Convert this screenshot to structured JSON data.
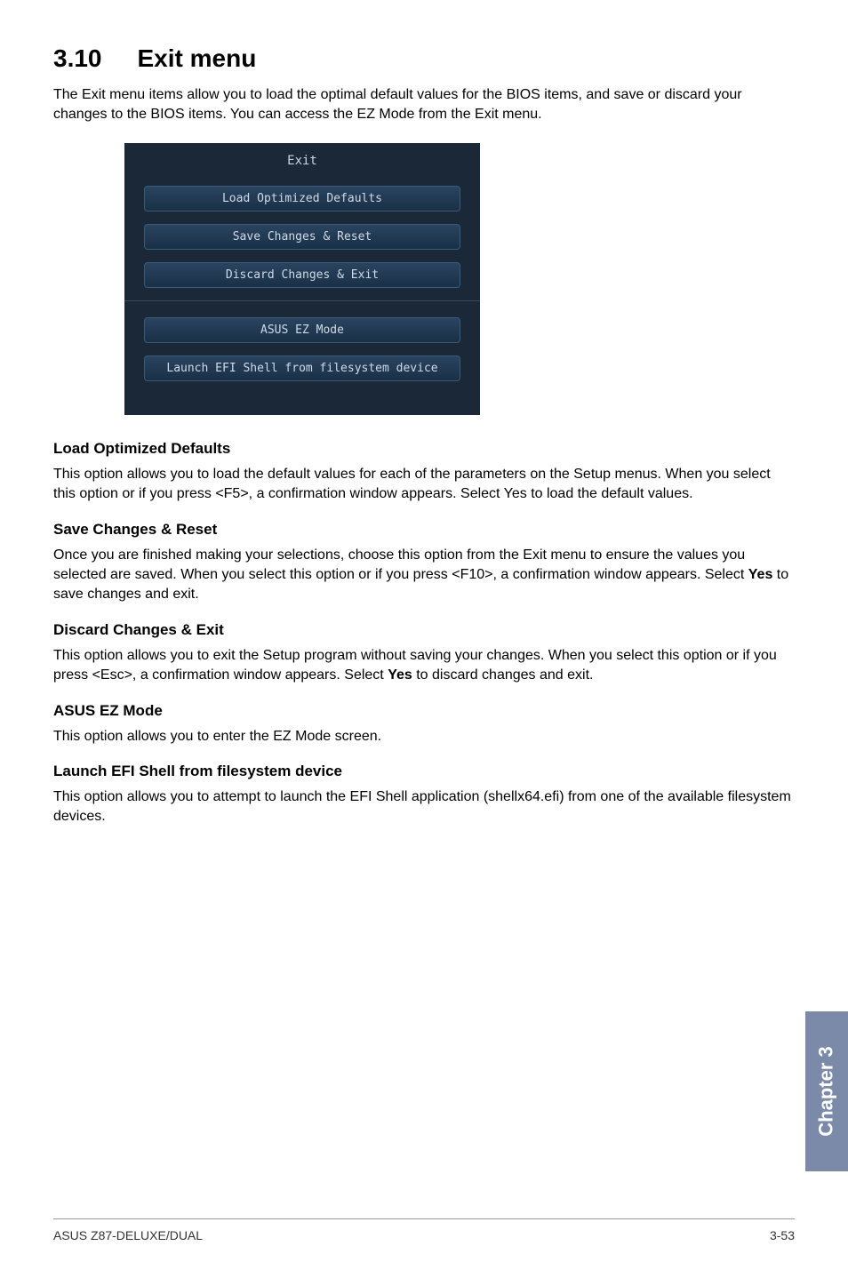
{
  "heading": {
    "section_number": "3.10",
    "title": "Exit menu"
  },
  "intro": "The Exit menu items allow you to load the optimal default values for the BIOS items, and save or discard your changes to the BIOS items. You can access the EZ Mode from the Exit menu.",
  "bios": {
    "header": "Exit",
    "buttons": {
      "load_defaults": "Load Optimized Defaults",
      "save_reset": "Save Changes & Reset",
      "discard_exit": "Discard Changes & Exit",
      "ez_mode": "ASUS EZ Mode",
      "launch_efi": "Launch EFI Shell from filesystem device"
    }
  },
  "sections": {
    "load_defaults": {
      "title": "Load Optimized Defaults",
      "body": "This option allows you to load the default values for each of the parameters on the Setup menus. When you select this option or if you press <F5>, a confirmation window appears. Select Yes to load the default values."
    },
    "save_reset": {
      "title": "Save Changes & Reset",
      "body_pre": "Once you are finished making your selections, choose this option from the Exit menu to ensure the values you selected are saved. When you select this option or if you press <F10>, a confirmation window appears. Select ",
      "body_bold": "Yes",
      "body_post": " to save changes and exit."
    },
    "discard_exit": {
      "title": "Discard Changes & Exit",
      "body_pre": "This option allows you to exit the Setup program without saving your changes. When you select this option or if you press <Esc>, a confirmation window appears. Select ",
      "body_bold": "Yes",
      "body_post": " to discard changes and exit."
    },
    "ez_mode": {
      "title": "ASUS EZ Mode",
      "body": "This option allows you to enter the EZ Mode screen."
    },
    "launch_efi": {
      "title": "Launch EFI Shell from filesystem device",
      "body": "This option allows you to attempt to launch the EFI Shell application (shellx64.efi) from one of the available filesystem devices."
    }
  },
  "chapter_tab": "Chapter 3",
  "footer": {
    "left": "ASUS Z87-DELUXE/DUAL",
    "right": "3-53"
  }
}
